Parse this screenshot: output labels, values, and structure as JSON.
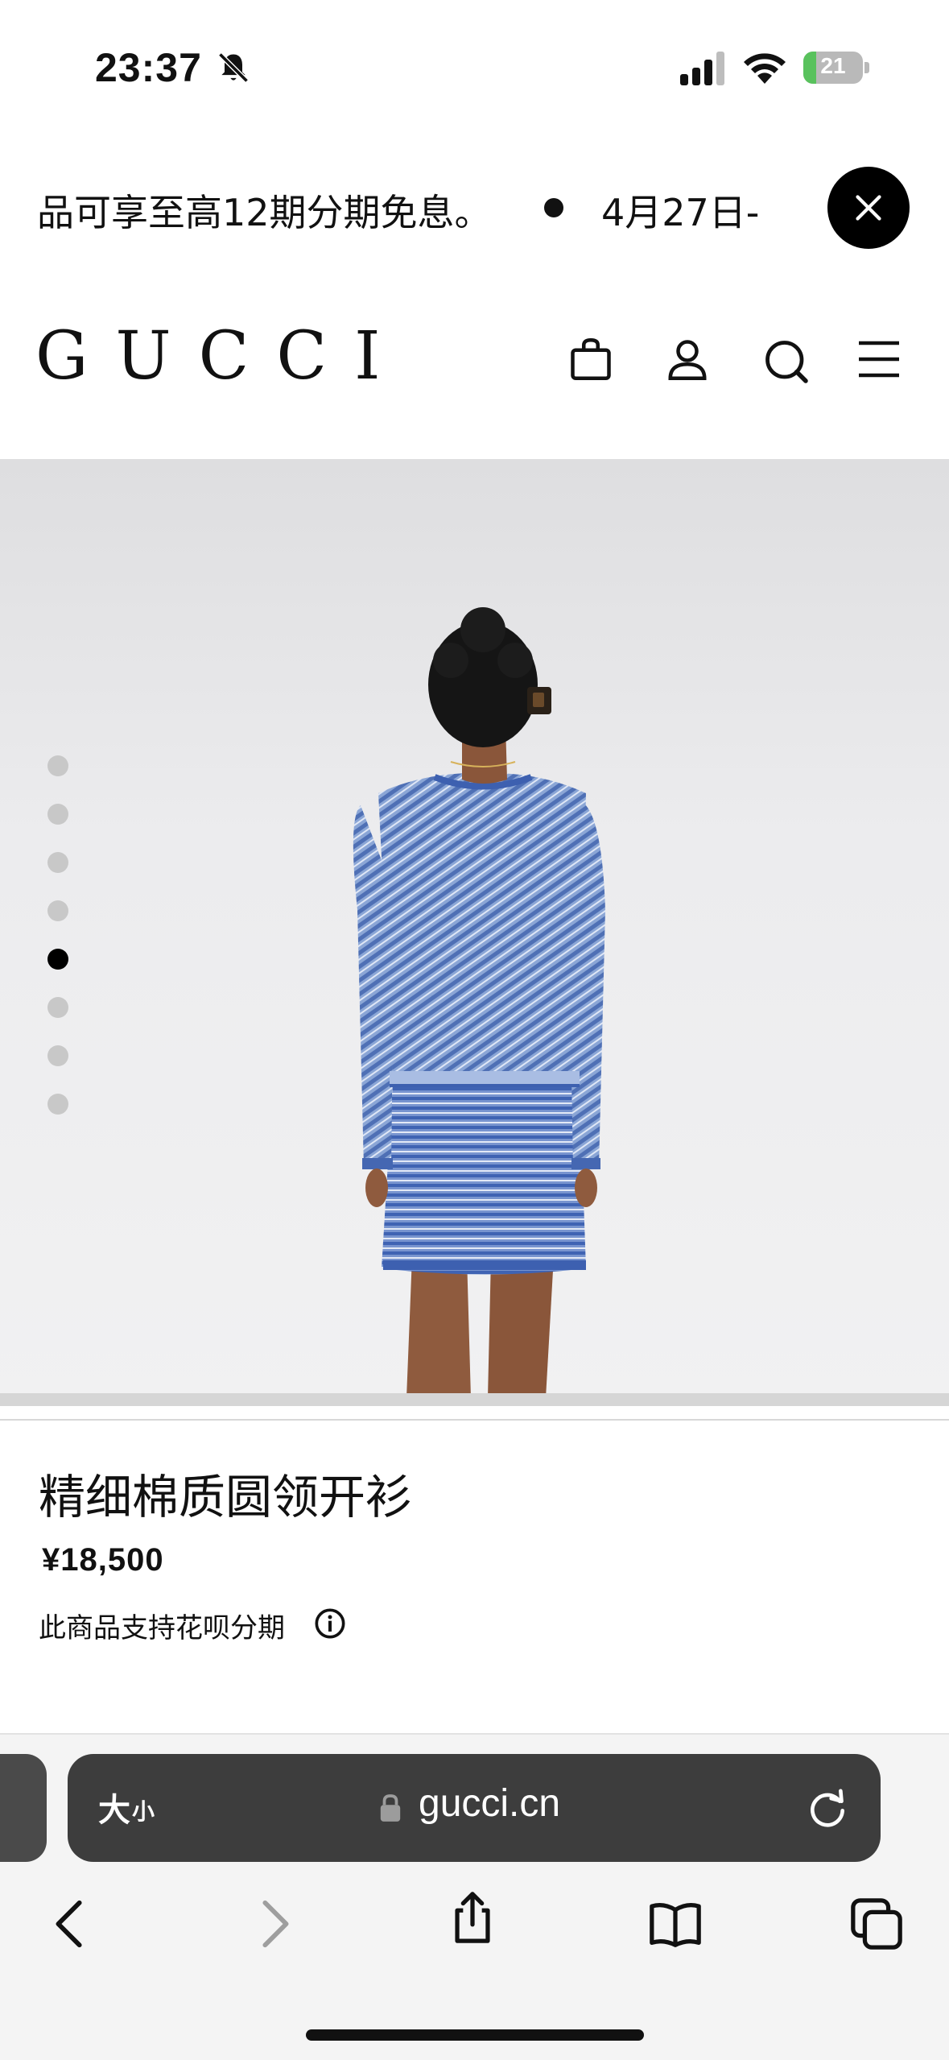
{
  "status_bar": {
    "time": "23:37",
    "battery_level": "21",
    "battery_fraction": 0.21,
    "icons": [
      "bell-slash-icon",
      "cellular-signal-icon",
      "wifi-icon",
      "battery-charging-icon"
    ]
  },
  "promo_banner": {
    "text_1": "品可享至高12期分期免息。",
    "text_2": "4月27日-",
    "close_icon": "close-icon"
  },
  "header": {
    "logo": "GUCCI",
    "icons": [
      "shopping-bag-icon",
      "account-icon",
      "search-icon",
      "menu-icon"
    ]
  },
  "carousel": {
    "total_images": 8,
    "active_index": 5
  },
  "product": {
    "name": "精细棉质圆领开衫",
    "price": "¥18,500",
    "installment_note": "此商品支持花呗分期",
    "info_icon": "info-icon"
  },
  "browser": {
    "text_size_label_big": "大",
    "text_size_label_small": "小",
    "url": "gucci.cn",
    "icons": [
      "lock-icon",
      "reload-icon",
      "back-icon",
      "forward-icon",
      "share-icon",
      "bookmarks-icon",
      "tabs-icon"
    ]
  },
  "colors": {
    "battery_green": "#59c25d",
    "sweater_blue": "#6d8ec7",
    "url_bar": "#3d3d3d"
  }
}
